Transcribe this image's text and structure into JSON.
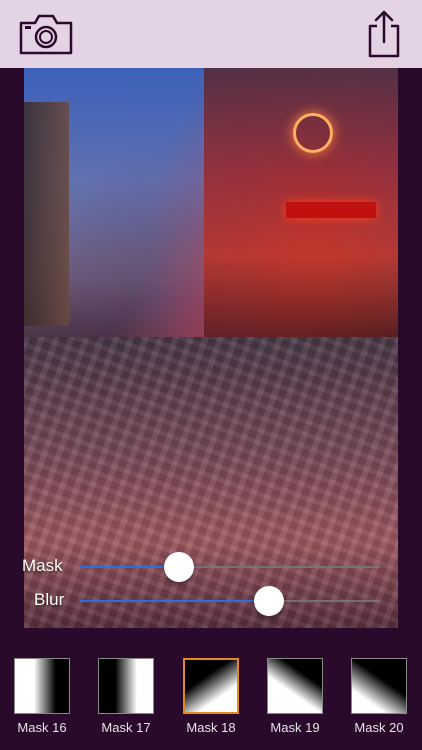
{
  "toolbar": {
    "camera_icon": "camera-icon",
    "share_icon": "share-icon",
    "background": "#e4d3e4",
    "icon_color": "#2a0a2a"
  },
  "sliders": {
    "mask": {
      "label": "Mask",
      "value": 0.33
    },
    "blur": {
      "label": "Blur",
      "value": 0.63
    }
  },
  "masks": [
    {
      "label": "Mask 16",
      "selected": false
    },
    {
      "label": "Mask 17",
      "selected": false
    },
    {
      "label": "Mask 18",
      "selected": true
    },
    {
      "label": "Mask 19",
      "selected": false
    },
    {
      "label": "Mask 20",
      "selected": false
    }
  ],
  "colors": {
    "background": "#2a0a2a",
    "accent": "#e08a20",
    "slider_fill": "#2a6fe0"
  }
}
